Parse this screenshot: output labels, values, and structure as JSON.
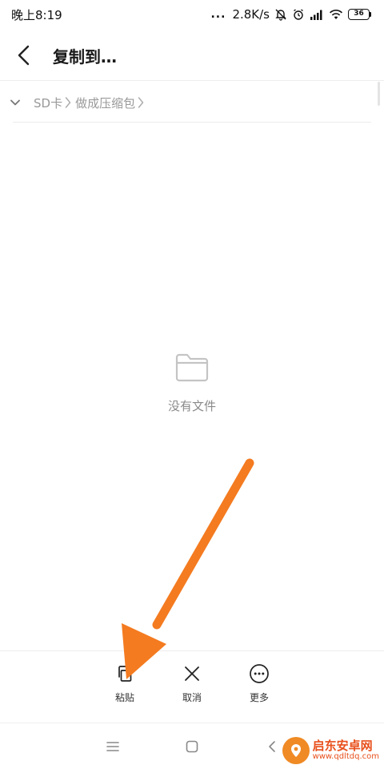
{
  "status_bar": {
    "time": "晚上8:19",
    "more": "...",
    "net_speed": "2.8K/s",
    "battery": "36"
  },
  "header": {
    "title": "复制到…"
  },
  "breadcrumb": {
    "items": [
      "SD卡",
      "做成压缩包"
    ]
  },
  "empty_state": {
    "text": "没有文件"
  },
  "actions": [
    {
      "label": "粘贴",
      "icon": "paste-icon"
    },
    {
      "label": "取消",
      "icon": "close-icon"
    },
    {
      "label": "更多",
      "icon": "more-icon"
    }
  ],
  "annotation": {
    "color": "#f47b20"
  },
  "watermark": {
    "main": "启东安卓网",
    "url": "www.qdltdq.com"
  }
}
